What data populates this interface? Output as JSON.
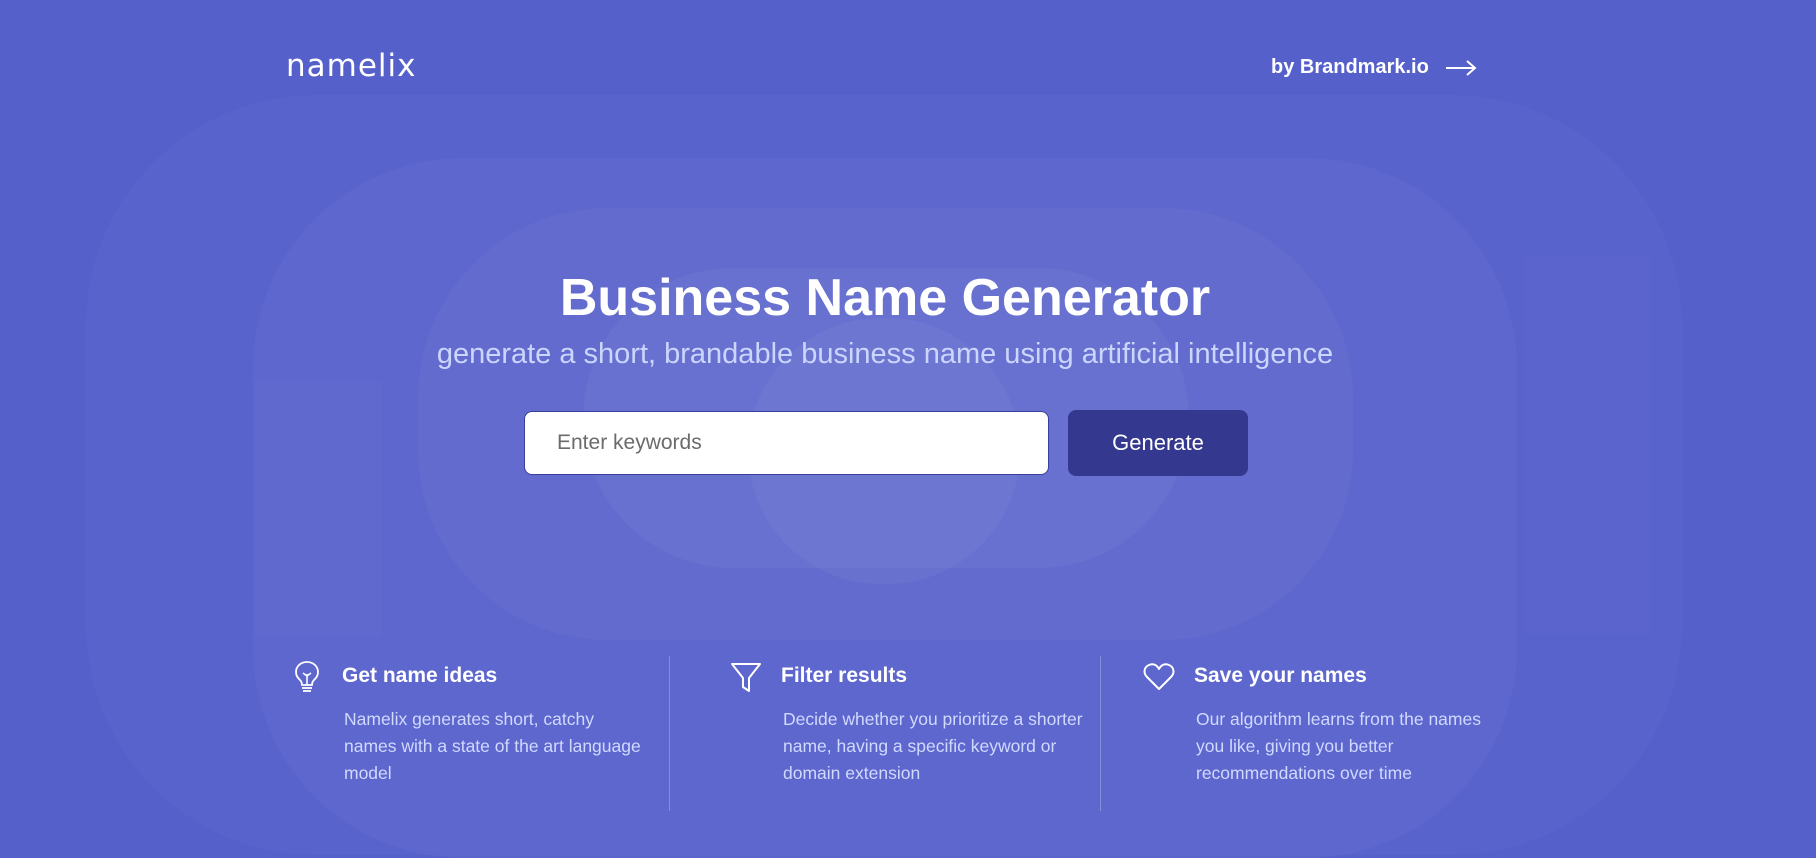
{
  "header": {
    "logo_text": "namelix",
    "brandmark_link": "by Brandmark.io"
  },
  "hero": {
    "title": "Business Name Generator",
    "subtitle": "generate a short, brandable business name using artificial intelligence"
  },
  "search": {
    "placeholder": "Enter keywords",
    "value": "",
    "button_label": "Generate"
  },
  "features": [
    {
      "icon": "lightbulb-icon",
      "title": "Get name ideas",
      "description": "Namelix generates short, catchy names with a state of the art language model"
    },
    {
      "icon": "filter-icon",
      "title": "Filter results",
      "description": "Decide whether you prioritize a shorter name, having a specific keyword or domain extension"
    },
    {
      "icon": "heart-icon",
      "title": "Save your names",
      "description": "Our algorithm learns from the names you like, giving you better recommendations over time"
    }
  ],
  "colors": {
    "background": "#5660cb",
    "button": "#35388f",
    "subtitle": "#cbd6ff",
    "feature_text": "#d0d9ff"
  }
}
